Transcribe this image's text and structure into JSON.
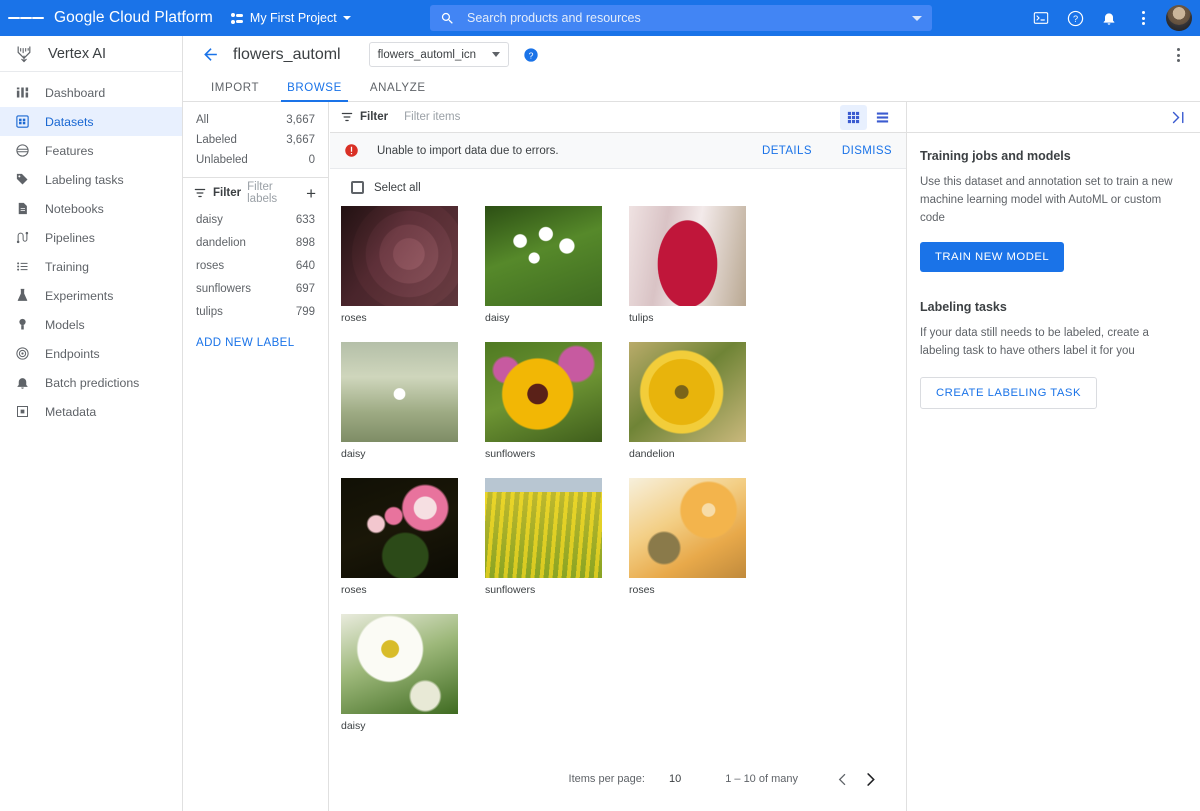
{
  "topbar": {
    "menu_icon": "hamburger-icon",
    "brand": "Google Cloud Platform",
    "project": "My First Project",
    "search_placeholder": "Search products and resources",
    "icons": [
      "cloud-shell-icon",
      "help-icon",
      "notifications-icon",
      "more-options-icon",
      "account-avatar"
    ]
  },
  "sidebar": {
    "product": "Vertex AI",
    "items": [
      {
        "label": "Dashboard",
        "icon": "dashboard-icon",
        "active": false
      },
      {
        "label": "Datasets",
        "icon": "datasets-icon",
        "active": true
      },
      {
        "label": "Features",
        "icon": "features-icon",
        "active": false
      },
      {
        "label": "Labeling tasks",
        "icon": "label-tag-icon",
        "active": false
      },
      {
        "label": "Notebooks",
        "icon": "notebook-icon",
        "active": false
      },
      {
        "label": "Pipelines",
        "icon": "pipelines-icon",
        "active": false
      },
      {
        "label": "Training",
        "icon": "training-list-icon",
        "active": false
      },
      {
        "label": "Experiments",
        "icon": "experiments-flask-icon",
        "active": false
      },
      {
        "label": "Models",
        "icon": "models-icon",
        "active": false
      },
      {
        "label": "Endpoints",
        "icon": "endpoints-icon",
        "active": false
      },
      {
        "label": "Batch predictions",
        "icon": "batch-predictions-icon",
        "active": false
      },
      {
        "label": "Metadata",
        "icon": "metadata-icon",
        "active": false
      }
    ]
  },
  "header": {
    "back_icon": "back-arrow-icon",
    "dataset_title": "flowers_automl",
    "annotation_set": "flowers_automl_icn",
    "help_icon": "help-circle-icon",
    "overflow_icon": "more-vert-icon",
    "tabs": [
      {
        "label": "IMPORT",
        "active": false
      },
      {
        "label": "BROWSE",
        "active": true
      },
      {
        "label": "ANALYZE",
        "active": false
      }
    ]
  },
  "label_panel": {
    "counts": [
      {
        "label": "All",
        "value": "3,667"
      },
      {
        "label": "Labeled",
        "value": "3,667"
      },
      {
        "label": "Unlabeled",
        "value": "0"
      }
    ],
    "filter_label": "Filter",
    "filter_placeholder": "Filter labels",
    "add_icon": "plus-icon",
    "labels": [
      {
        "label": "daisy",
        "value": "633"
      },
      {
        "label": "dandelion",
        "value": "898"
      },
      {
        "label": "roses",
        "value": "640"
      },
      {
        "label": "sunflowers",
        "value": "697"
      },
      {
        "label": "tulips",
        "value": "799"
      }
    ],
    "add_new_label": "ADD NEW LABEL"
  },
  "item_area": {
    "filter_label": "Filter",
    "filter_placeholder": "Filter items",
    "grid_view_icon": "grid-view-icon",
    "list_view_icon": "list-view-icon",
    "error": {
      "icon": "error-icon",
      "message": "Unable to import data due to errors.",
      "details_label": "DETAILS",
      "dismiss_label": "DISMISS",
      "color": "#d93025"
    },
    "select_all": "Select all",
    "items": [
      {
        "caption": "roses",
        "c1": "#b07886",
        "c2": "#6e5257",
        "c3": "#d9b4b4"
      },
      {
        "caption": "daisy",
        "c1": "#3f6b21",
        "c2": "#87b34b",
        "c3": "#f2f3e4"
      },
      {
        "caption": "tulips",
        "c1": "#c0163a",
        "c2": "#e8d3d6",
        "c3": "#8d0f2a"
      },
      {
        "caption": "daisy",
        "c1": "#9ba88a",
        "c2": "#d7dbc4",
        "c3": "#7e8d70"
      },
      {
        "caption": "sunflowers",
        "c1": "#f2b705",
        "c2": "#5d7d2b",
        "c3": "#c75aa0"
      },
      {
        "caption": "dandelion",
        "c1": "#f0c020",
        "c2": "#9b8a3c",
        "c3": "#d9a40d"
      },
      {
        "caption": "roses",
        "c1": "#e8739d",
        "c2": "#141208",
        "c3": "#f3c7cf"
      },
      {
        "caption": "sunflowers",
        "c1": "#c9b45e",
        "c2": "#7e8c3f",
        "c3": "#b9c3cc"
      },
      {
        "caption": "roses",
        "c1": "#f3b44c",
        "c2": "#f7e6bd",
        "c3": "#c79a4f"
      },
      {
        "caption": "daisy",
        "c1": "#f0f2ea",
        "c2": "#3f6b21",
        "c3": "#d8bc2a"
      }
    ],
    "pagination": {
      "items_per_page_label": "Items per page:",
      "items_per_page_value": "10",
      "range": "1 – 10 of many",
      "prev_icon": "chevron-left-icon",
      "next_icon": "chevron-right-icon"
    }
  },
  "right_panel": {
    "collapse_icon": "collapse-panel-icon",
    "training_heading": "Training jobs and models",
    "training_text": "Use this dataset and annotation set to train a new machine learning model with AutoML or custom code",
    "train_button": "TRAIN NEW MODEL",
    "labeling_heading": "Labeling tasks",
    "labeling_text": "If your data still needs to be labeled, create a labeling task to have others label it for you",
    "labeling_button": "CREATE LABELING TASK"
  },
  "theme": {
    "accent": "#1a73e8",
    "accent_dark": "#1967d2",
    "error": "#d93025",
    "text": "#3c4043",
    "muted": "#5f6368"
  }
}
